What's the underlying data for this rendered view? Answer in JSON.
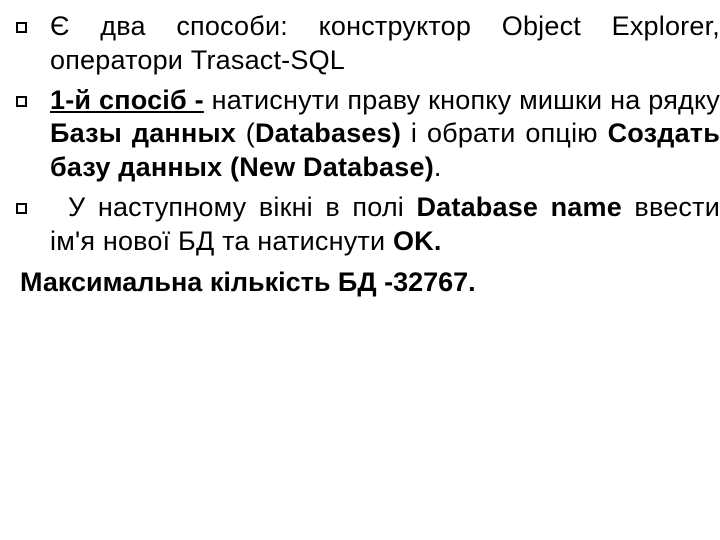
{
  "items": [
    {
      "runs": [
        {
          "t": "Є два способи: конструктор Object Explorer, оператори Trasact-SQL"
        }
      ]
    },
    {
      "runs": [
        {
          "t": "1-й спосіб -",
          "b": true,
          "u": true
        },
        {
          "t": " натиснути праву кнопку мишки на рядку "
        },
        {
          "t": "Базы данных",
          "b": true
        },
        {
          "t": " ("
        },
        {
          "t": "Databases)",
          "b": true
        },
        {
          "t": " і обрати опцію "
        },
        {
          "t": "Создать базу данных (New Database)",
          "b": true
        },
        {
          "t": "."
        }
      ]
    },
    {
      "lead_indent": true,
      "runs": [
        {
          "t": "У наступному вікні в полі "
        },
        {
          "t": "Database name",
          "b": true
        },
        {
          "t": " ввести ім'я нової БД та натиснути "
        },
        {
          "t": "OK.",
          "b": true
        }
      ]
    }
  ],
  "footer": "Максимальна кількість БД -32767."
}
